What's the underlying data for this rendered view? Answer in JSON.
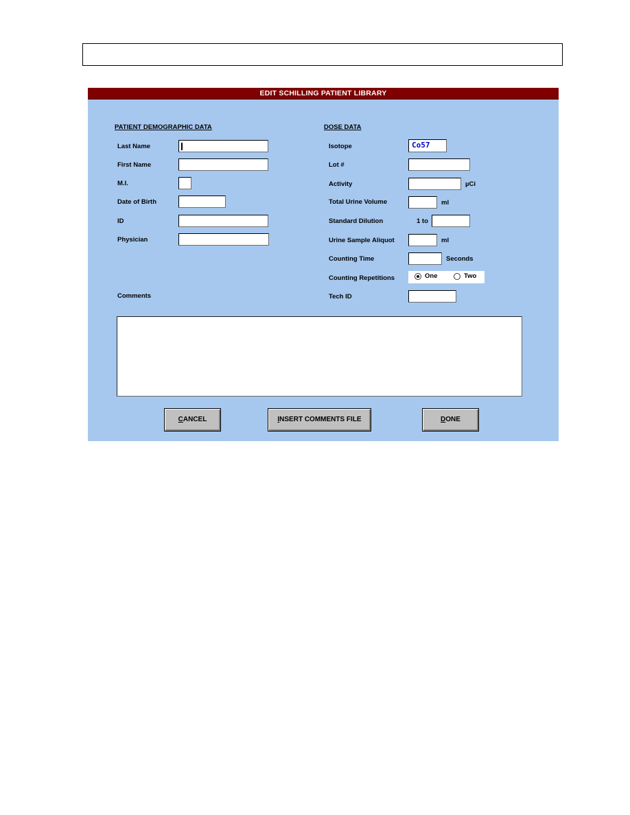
{
  "dialog": {
    "title": "EDIT SCHILLING PATIENT LIBRARY"
  },
  "demographic": {
    "heading": "PATIENT DEMOGRAPHIC DATA",
    "fields": [
      {
        "label": "Last Name",
        "value": ""
      },
      {
        "label": "First Name",
        "value": ""
      },
      {
        "label": "M.I.",
        "value": ""
      },
      {
        "label": "Date of Birth",
        "value": ""
      },
      {
        "label": "ID",
        "value": ""
      },
      {
        "label": "Physician",
        "value": ""
      }
    ],
    "comments_label": "Comments",
    "comments_value": ""
  },
  "dose": {
    "heading": "DOSE DATA",
    "isotope": {
      "label": "Isotope",
      "value": "Co57"
    },
    "lot": {
      "label": "Lot #",
      "value": ""
    },
    "activity": {
      "label": "Activity",
      "value": "",
      "unit": "µCi"
    },
    "total_urine_volume": {
      "label": "Total Urine Volume",
      "value": "",
      "unit": "ml"
    },
    "standard_dilution": {
      "label": "Standard Dilution",
      "prefix": "1 to",
      "value": ""
    },
    "urine_sample_aliquot": {
      "label": "Urine Sample Aliquot",
      "value": "",
      "unit": "ml"
    },
    "counting_time": {
      "label": "Counting Time",
      "value": "",
      "unit": "Seconds"
    },
    "counting_repetitions": {
      "label": "Counting Repetitions",
      "options": [
        {
          "label": "One",
          "selected": true
        },
        {
          "label": "Two",
          "selected": false
        }
      ]
    },
    "tech_id": {
      "label": "Tech ID",
      "value": ""
    }
  },
  "buttons": {
    "cancel": {
      "accel": "C",
      "rest": "ANCEL"
    },
    "insert": {
      "accel": "I",
      "rest": "NSERT COMMENTS FILE"
    },
    "done": {
      "accel": "D",
      "rest": "ONE"
    }
  },
  "colors": {
    "titlebar": "#800000",
    "dialog_bg": "#a6c8ef",
    "button_face": "#c0c0c0",
    "isotope_text": "#0000cc"
  }
}
